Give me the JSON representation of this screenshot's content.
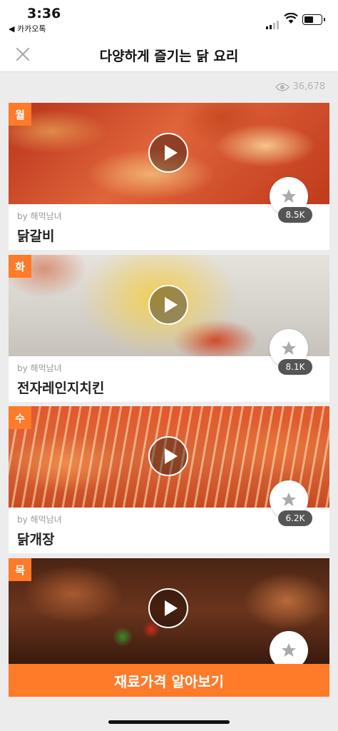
{
  "status_bar": {
    "time": "3:36",
    "back_app": "◀ 카카오톡"
  },
  "header": {
    "title": "다양하게 즐기는 닭 요리"
  },
  "views": {
    "count": "36,678"
  },
  "cards": [
    {
      "day": "월",
      "author": "by 해먹남녀",
      "name": "닭갈비",
      "likes": "8.5K"
    },
    {
      "day": "화",
      "author": "by 해먹남녀",
      "name": "전자레인지치킨",
      "likes": "8.1K"
    },
    {
      "day": "수",
      "author": "by 해먹남녀",
      "name": "닭개장",
      "likes": "6.2K"
    },
    {
      "day": "목"
    }
  ],
  "cta": {
    "label": "재료가격 알아보기"
  },
  "colors": {
    "accent": "#ff7a29"
  }
}
